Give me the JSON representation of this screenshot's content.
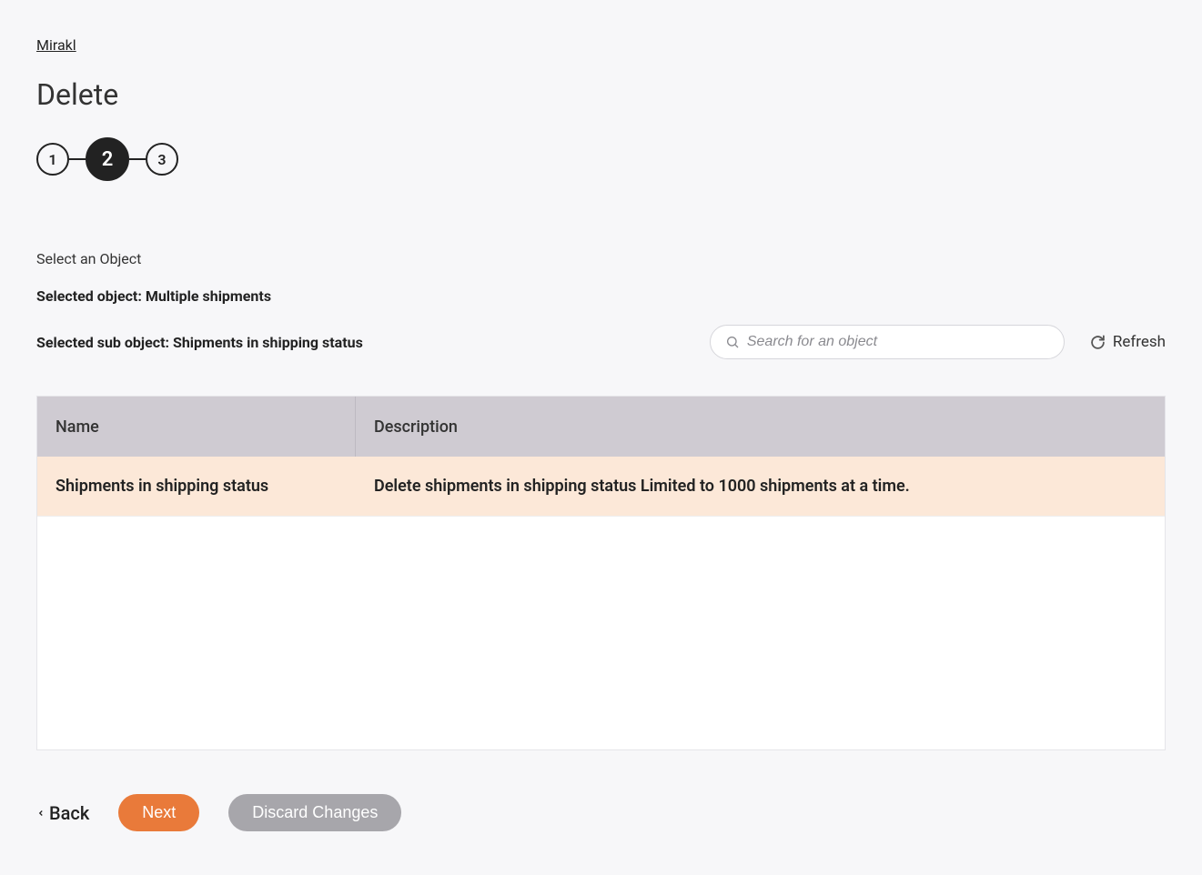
{
  "breadcrumb": {
    "label": "Mirakl"
  },
  "page": {
    "title": "Delete"
  },
  "stepper": {
    "steps": [
      "1",
      "2",
      "3"
    ],
    "active_index": 1
  },
  "labels": {
    "select_object": "Select an Object",
    "selected_object_prefix": "Selected object: ",
    "selected_object_value": "Multiple shipments",
    "selected_sub_prefix": "Selected sub object: ",
    "selected_sub_value": "Shipments in shipping status"
  },
  "search": {
    "placeholder": "Search for an object"
  },
  "refresh": {
    "label": "Refresh"
  },
  "table": {
    "columns": {
      "name": "Name",
      "description": "Description"
    },
    "rows": [
      {
        "name": "Shipments in shipping status",
        "description": "Delete shipments in shipping status Limited to 1000 shipments at a time."
      }
    ]
  },
  "footer": {
    "back": "Back",
    "next": "Next",
    "discard": "Discard Changes"
  }
}
